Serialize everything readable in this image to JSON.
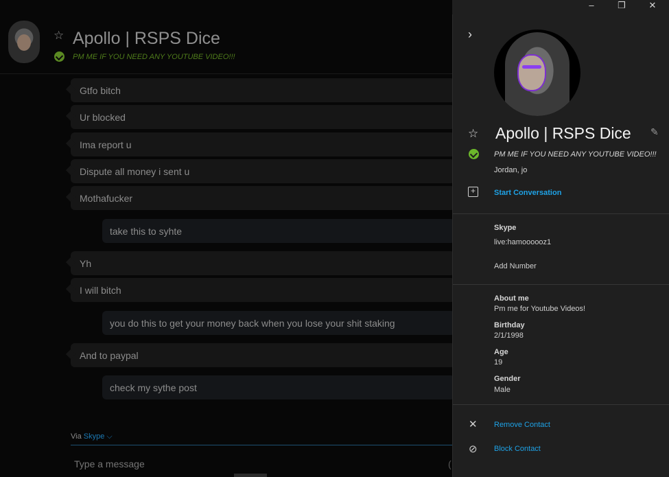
{
  "window": {
    "minimize_glyph": "–",
    "restore_glyph": "❐",
    "close_glyph": "✕"
  },
  "chat": {
    "contact_name": "Apollo | RSPS Dice",
    "mood": "PM ME IF YOU NEED ANY YOUTUBE VIDEO!!!",
    "messages": [
      {
        "dir": "in",
        "text": "Gtfo bitch"
      },
      {
        "dir": "in",
        "text": "Ur blocked"
      },
      {
        "dir": "in",
        "text": "Ima report u"
      },
      {
        "dir": "in",
        "text": "Dispute all money i sent u"
      },
      {
        "dir": "in",
        "text": "Mothafucker"
      },
      {
        "dir": "out",
        "text": "take this to syhte"
      },
      {
        "dir": "in",
        "text": "Yh"
      },
      {
        "dir": "in",
        "text": "I will bitch"
      },
      {
        "dir": "out",
        "text": "you do this to get your money back when you lose your shit staking"
      },
      {
        "dir": "in",
        "text": "And to paypal"
      },
      {
        "dir": "out",
        "text": "check my sythe post"
      }
    ],
    "via_label": "Via",
    "via_service": "Skype ⌵",
    "compose_placeholder": "Type a message"
  },
  "profile": {
    "collapse_glyph": "›",
    "name": "Apollo | RSPS Dice",
    "mood": "PM ME IF YOU NEED ANY YOUTUBE VIDEO!!!",
    "alias": "Jordan, jo",
    "start_conversation": "Start Conversation",
    "skype_label": "Skype",
    "skype_id": "live:hamoooooz1",
    "add_number": "Add Number",
    "about_label": "About me",
    "about_value": "Pm me for Youtube Videos!",
    "birthday_label": "Birthday",
    "birthday_value": "2/1/1998",
    "age_label": "Age",
    "age_value": "19",
    "gender_label": "Gender",
    "gender_value": "Male",
    "remove_contact": "Remove Contact",
    "block_contact": "Block Contact"
  },
  "colors": {
    "accent_link": "#1fa2e6",
    "online_green": "#6cb72b",
    "panel_bg": "#1f1f1f"
  }
}
